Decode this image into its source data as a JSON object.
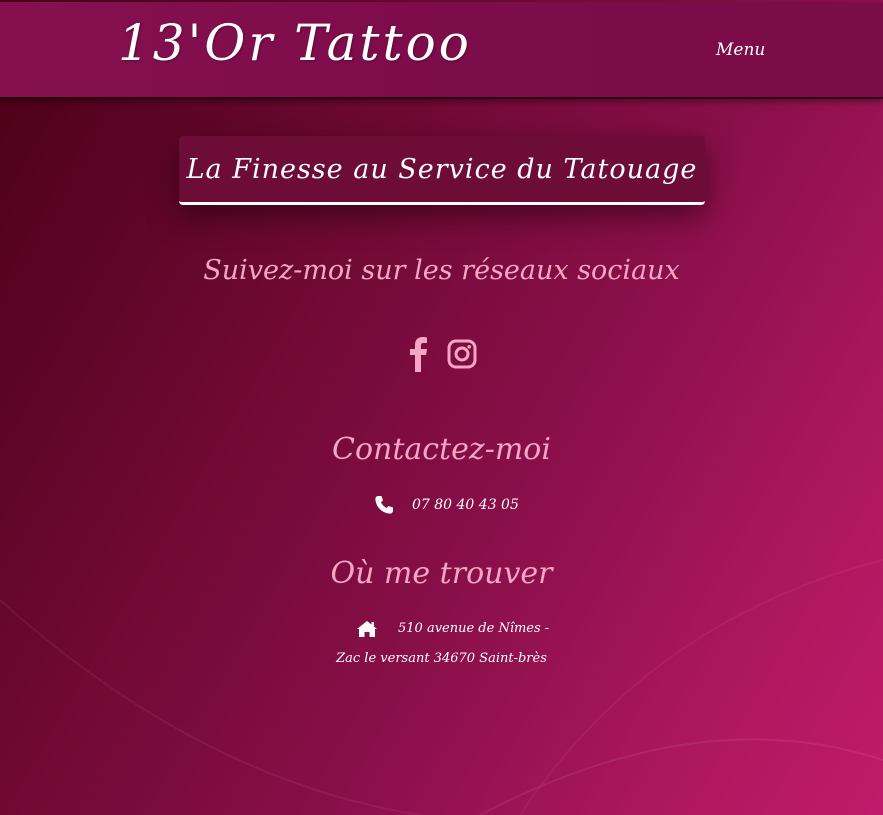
{
  "header": {
    "logo_text": "13'Or Tattoo",
    "menu_label": "Menu"
  },
  "hero": {
    "tagline": "La Finesse au Service du Tatouage"
  },
  "social": {
    "heading": "Suivez-moi sur les réseaux sociaux",
    "icons": [
      "facebook-icon",
      "instagram-icon"
    ]
  },
  "contact": {
    "heading": "Contactez-moi",
    "phone": "07 80 40 43 05",
    "phone_icon": "phone-icon"
  },
  "location": {
    "heading": "Où me trouver",
    "address_line1": "510 avenue de Nîmes -",
    "address_line2": "Zac le versant 34670 Saint-brès",
    "address_icon": "home-icon"
  },
  "colors": {
    "header_bg": "#7d0c4a",
    "accent_pink": "#f4a6c3",
    "text_white": "#ffffff",
    "tagline_bg": "#6d0c36"
  }
}
